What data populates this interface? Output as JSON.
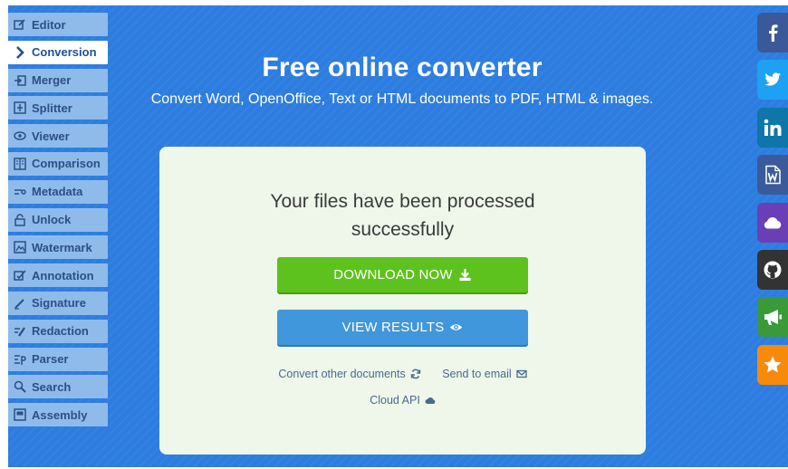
{
  "sidebar": {
    "items": [
      {
        "label": "Editor",
        "icon": "edit-icon",
        "active": false
      },
      {
        "label": "Conversion",
        "icon": "chevron-right-icon",
        "active": true
      },
      {
        "label": "Merger",
        "icon": "merge-icon",
        "active": false
      },
      {
        "label": "Splitter",
        "icon": "split-icon",
        "active": false
      },
      {
        "label": "Viewer",
        "icon": "eye-icon",
        "active": false
      },
      {
        "label": "Comparison",
        "icon": "compare-icon",
        "active": false
      },
      {
        "label": "Metadata",
        "icon": "metadata-icon",
        "active": false
      },
      {
        "label": "Unlock",
        "icon": "unlock-icon",
        "active": false
      },
      {
        "label": "Watermark",
        "icon": "watermark-icon",
        "active": false
      },
      {
        "label": "Annotation",
        "icon": "annotation-icon",
        "active": false
      },
      {
        "label": "Signature",
        "icon": "signature-icon",
        "active": false
      },
      {
        "label": "Redaction",
        "icon": "redaction-icon",
        "active": false
      },
      {
        "label": "Parser",
        "icon": "parser-icon",
        "active": false
      },
      {
        "label": "Search",
        "icon": "search-icon",
        "active": false
      },
      {
        "label": "Assembly",
        "icon": "assembly-icon",
        "active": false
      }
    ]
  },
  "header": {
    "title": "Free online converter",
    "subtitle": "Convert Word, OpenOffice, Text or HTML documents to PDF, HTML & images."
  },
  "card": {
    "message_line1": "Your files have been processed",
    "message_line2": "successfully",
    "download_label": "DOWNLOAD NOW",
    "view_label": "VIEW RESULTS",
    "convert_other_label": "Convert other documents",
    "send_email_label": "Send to email",
    "cloud_api_label": "Cloud API"
  },
  "social": [
    {
      "icon": "facebook-icon",
      "color": "#3b5998"
    },
    {
      "icon": "twitter-icon",
      "color": "#1da1f2"
    },
    {
      "icon": "linkedin-icon",
      "color": "#0e76a8"
    },
    {
      "icon": "word-doc-icon",
      "color": "#3b5a9a"
    },
    {
      "icon": "cloud-icon",
      "color": "#6a3fb5"
    },
    {
      "icon": "github-icon",
      "color": "#333333"
    },
    {
      "icon": "megaphone-icon",
      "color": "#3a9a3a"
    },
    {
      "icon": "star-icon",
      "color": "#f78a0a"
    }
  ],
  "colors": {
    "background": "#2d7de0",
    "download_button": "#5ec21e",
    "view_button": "#4197db",
    "card": "#eef7ea"
  }
}
